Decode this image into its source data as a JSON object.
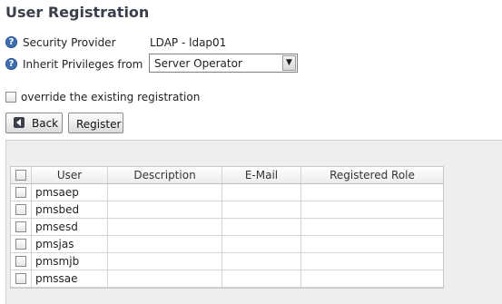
{
  "page": {
    "title": "User Registration"
  },
  "form": {
    "security_provider_label": "Security Provider",
    "security_provider_value": "LDAP - ldap01",
    "inherit_label": "Inherit Privileges from",
    "inherit_value": "Server Operator",
    "override_label": "override the existing registration"
  },
  "buttons": {
    "back_label": "Back",
    "register_label": "Register"
  },
  "icons": {
    "help": "help-icon",
    "back": "back-arrow-icon",
    "dropdown": "chevron-down-icon"
  },
  "table": {
    "columns": [
      "User",
      "Description",
      "E-Mail",
      "Registered Role"
    ],
    "rows": [
      {
        "user": "pmsaep",
        "description": "",
        "email": "",
        "role": ""
      },
      {
        "user": "pmsbed",
        "description": "",
        "email": "",
        "role": ""
      },
      {
        "user": "pmsesd",
        "description": "",
        "email": "",
        "role": ""
      },
      {
        "user": "pmsjas",
        "description": "",
        "email": "",
        "role": ""
      },
      {
        "user": "pmsmjb",
        "description": "",
        "email": "",
        "role": ""
      },
      {
        "user": "pmssae",
        "description": "",
        "email": "",
        "role": ""
      }
    ]
  }
}
